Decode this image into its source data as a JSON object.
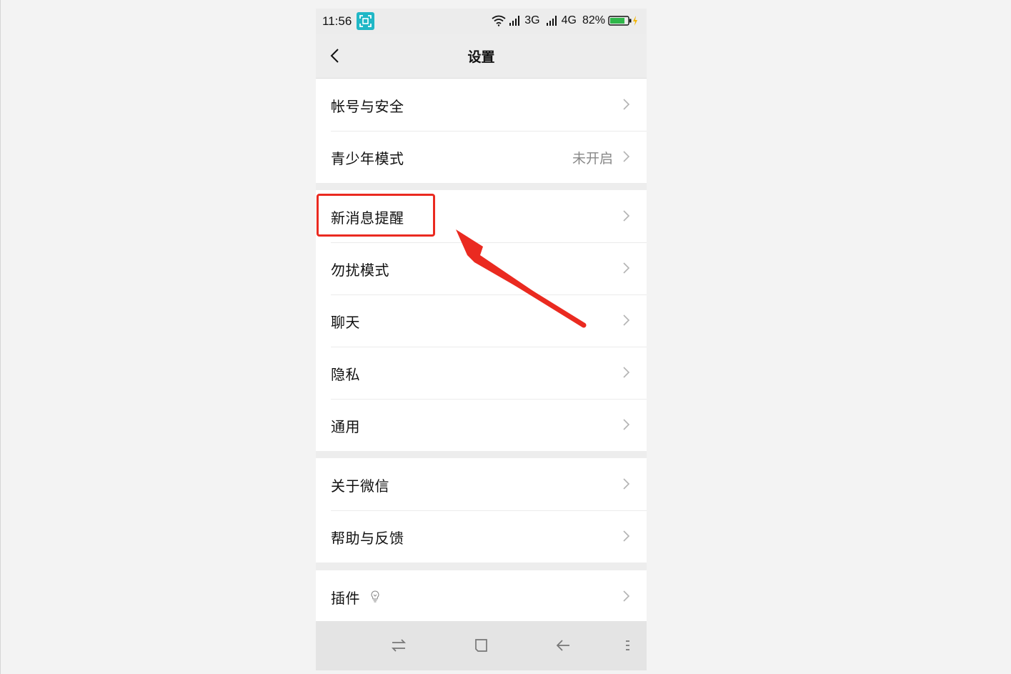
{
  "status_bar": {
    "time": "11:56",
    "network_1": "3G",
    "network_2": "4G",
    "battery": "82%",
    "colors": {
      "badge": "#20b7c6",
      "battery_fill": "#2fb74a"
    },
    "icons": [
      "screenshot-icon",
      "wifi-icon",
      "signal-icon",
      "signal-icon",
      "battery-icon",
      "charging-icon"
    ]
  },
  "nav": {
    "title": "设置",
    "back_icon": "back-arrow-icon"
  },
  "groups": [
    {
      "items": [
        {
          "label": "帐号与安全",
          "value": ""
        },
        {
          "label": "青少年模式",
          "value": "未开启"
        }
      ]
    },
    {
      "items": [
        {
          "label": "新消息提醒",
          "value": ""
        },
        {
          "label": "勿扰模式",
          "value": ""
        },
        {
          "label": "聊天",
          "value": ""
        },
        {
          "label": "隐私",
          "value": ""
        },
        {
          "label": "通用",
          "value": ""
        }
      ]
    },
    {
      "items": [
        {
          "label": "关于微信",
          "value": ""
        },
        {
          "label": "帮助与反馈",
          "value": ""
        }
      ]
    },
    {
      "items": [
        {
          "label": "插件",
          "value": ""
        }
      ]
    }
  ],
  "annotation": {
    "highlighted_item": "新消息提醒",
    "color": "#ea2a20"
  },
  "system_nav": {
    "buttons": [
      "switch-apps-icon",
      "home-icon",
      "back-icon",
      "menu-icon"
    ]
  }
}
